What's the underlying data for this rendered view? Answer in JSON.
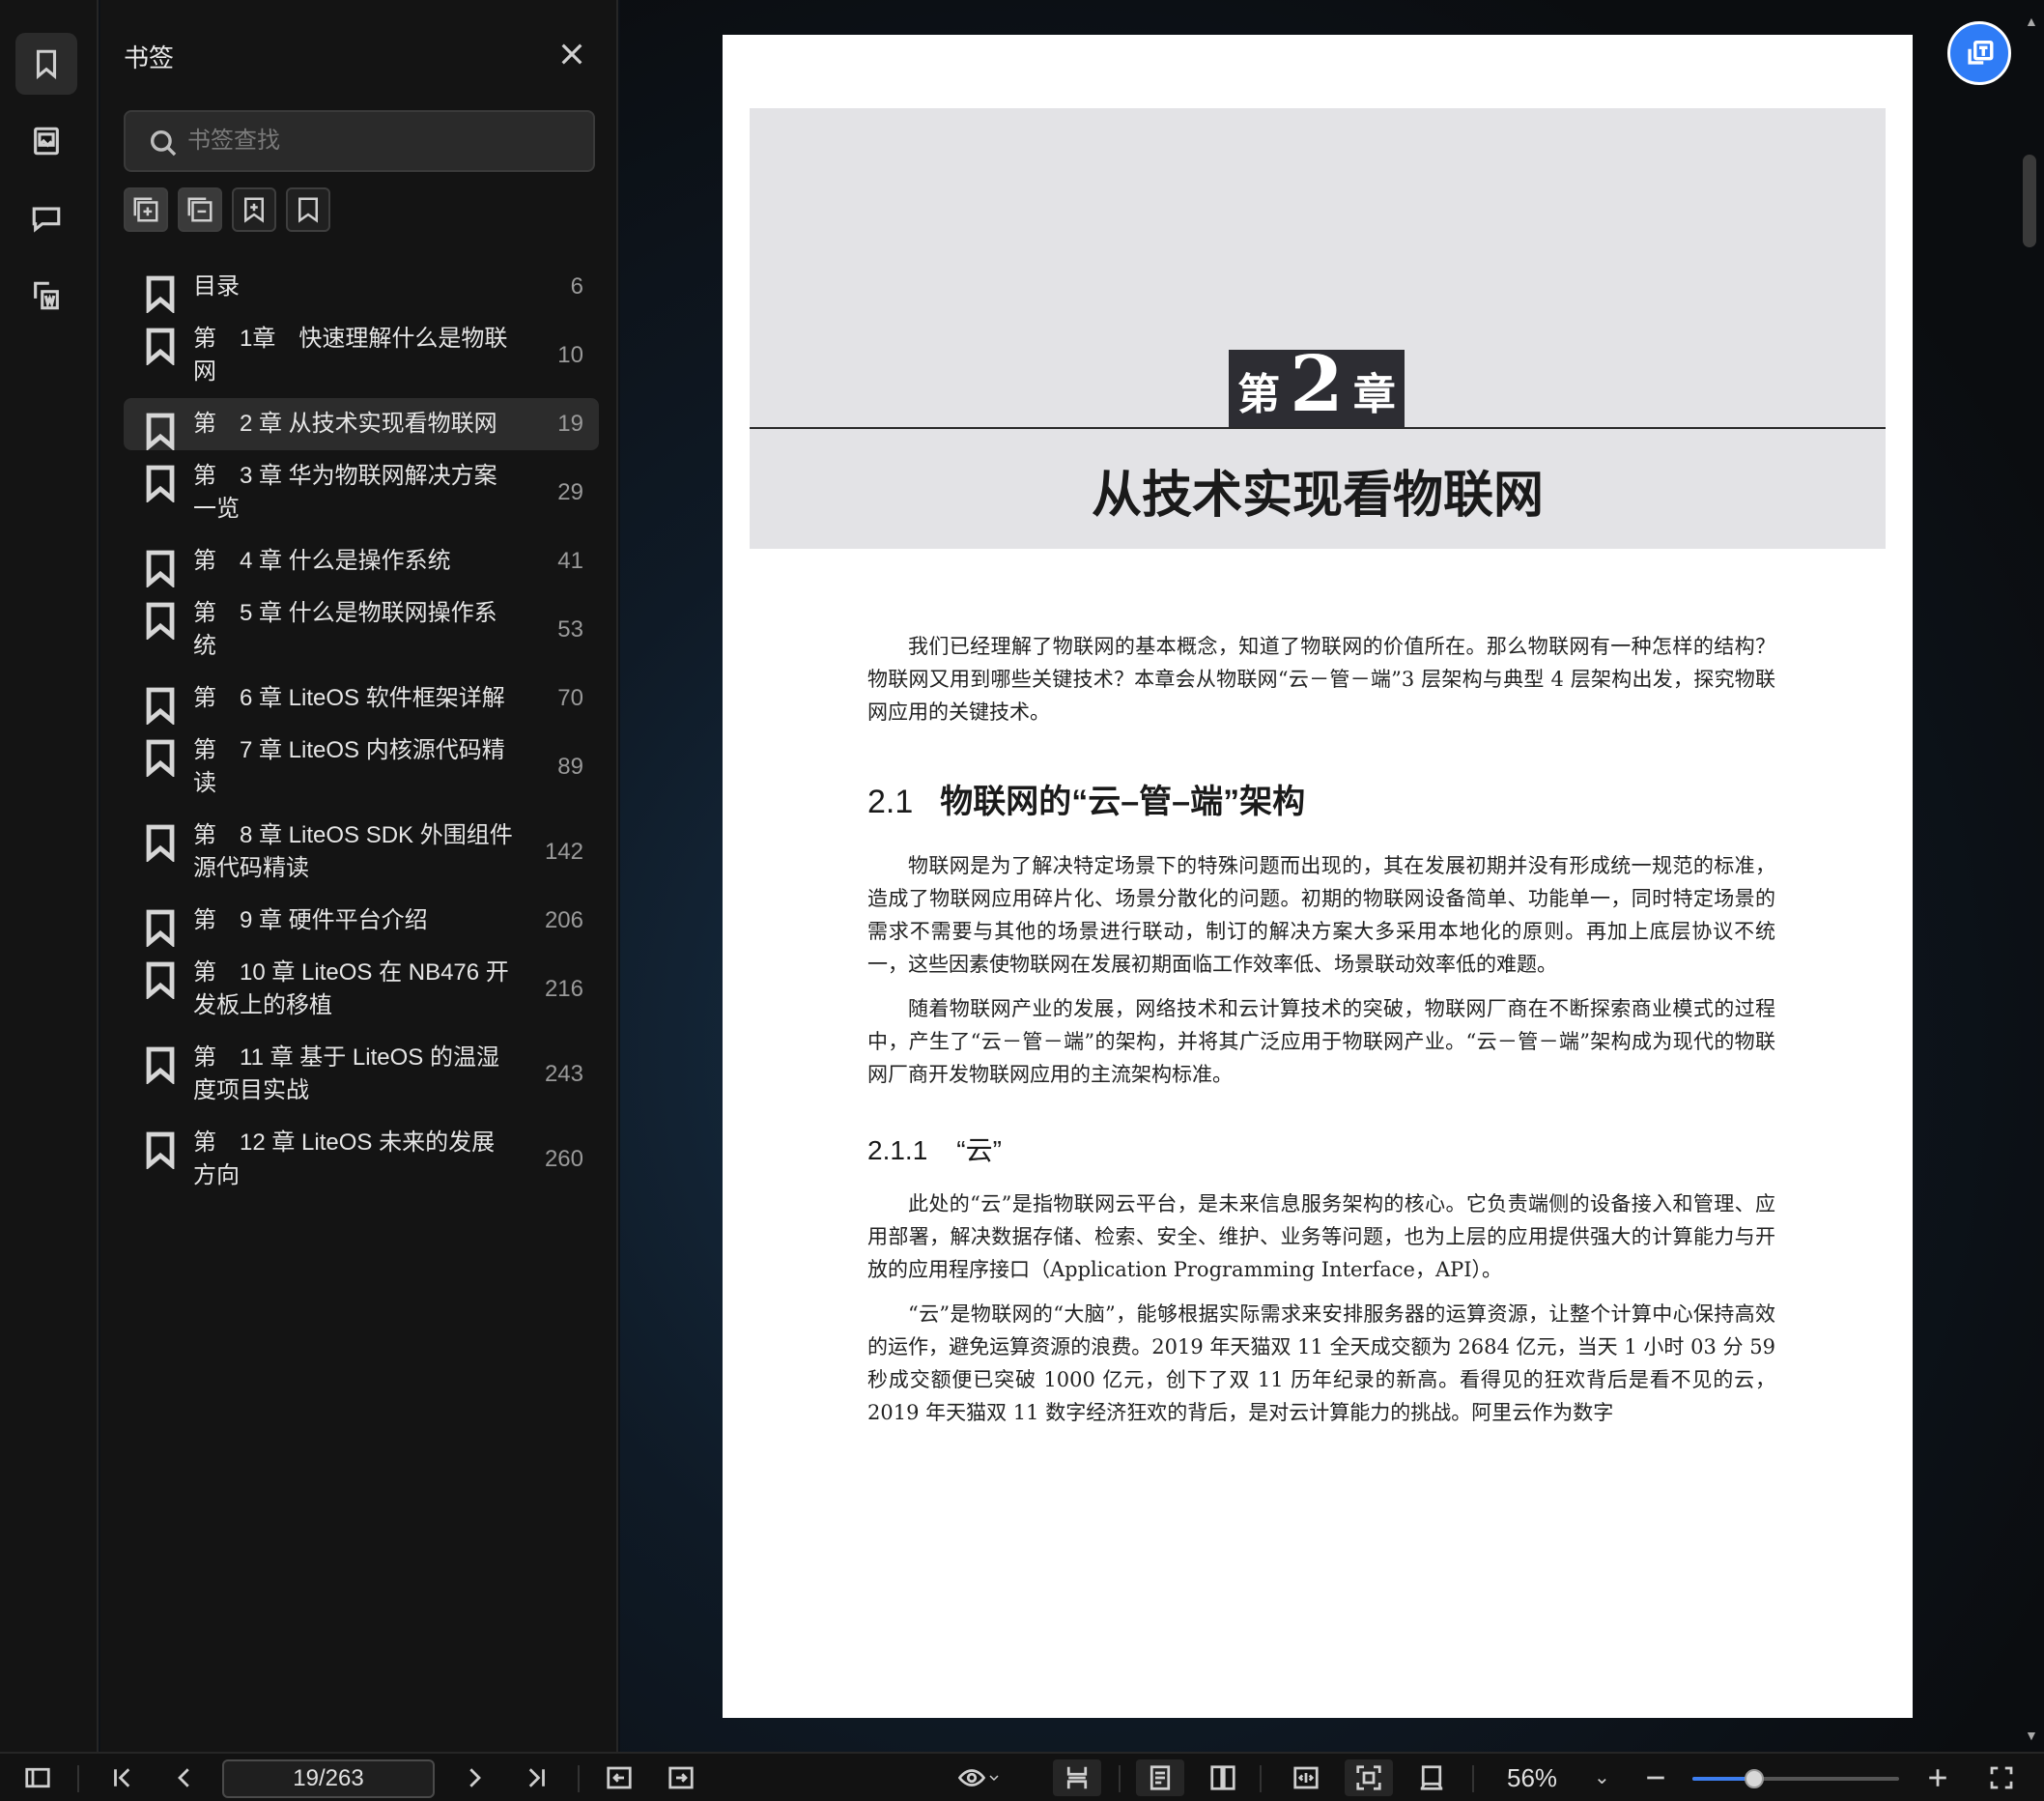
{
  "panel": {
    "title": "书签",
    "search_placeholder": "书签查找"
  },
  "bookmarks": [
    {
      "label": "目录",
      "page": "6"
    },
    {
      "label": "第　1章　快速理解什么是物联网",
      "page": "10"
    },
    {
      "label": "第　2 章 从技术实现看物联网",
      "page": "19",
      "active": true
    },
    {
      "label": "第　3 章 华为物联网解决方案一览",
      "page": "29"
    },
    {
      "label": "第　4 章 什么是操作系统",
      "page": "41"
    },
    {
      "label": "第　5 章 什么是物联网操作系统",
      "page": "53"
    },
    {
      "label": "第　6 章 LiteOS 软件框架详解",
      "page": "70"
    },
    {
      "label": "第　7 章 LiteOS 内核源代码精读",
      "page": "89"
    },
    {
      "label": "第　8 章 LiteOS SDK 外围组件源代码精读",
      "page": "142"
    },
    {
      "label": "第　9 章 硬件平台介绍",
      "page": "206"
    },
    {
      "label": "第　10 章 LiteOS 在 NB476 开发板上的移植",
      "page": "216"
    },
    {
      "label": "第　11 章 基于 LiteOS 的温湿度项目实战",
      "page": "243"
    },
    {
      "label": "第　12 章 LiteOS 未来的发展方向",
      "page": "260"
    }
  ],
  "document": {
    "chapter_prefix": "第",
    "chapter_number": "2",
    "chapter_suffix": "章",
    "chapter_title": "从技术实现看物联网",
    "intro": "我们已经理解了物联网的基本概念，知道了物联网的价值所在。那么物联网有一种怎样的结构？物联网又用到哪些关键技术？本章会从物联网“云－管－端”3 层架构与典型 4 层架构出发，探究物联网应用的关键技术。",
    "section_num": "2.1",
    "section_title": "物联网的“云–管–端”架构",
    "section_p1": "物联网是为了解决特定场景下的特殊问题而出现的，其在发展初期并没有形成统一规范的标准，造成了物联网应用碎片化、场景分散化的问题。初期的物联网设备简单、功能单一，同时特定场景的需求不需要与其他的场景进行联动，制订的解决方案大多采用本地化的原则。再加上底层协议不统一，这些因素使物联网在发展初期面临工作效率低、场景联动效率低的难题。",
    "section_p2": "随着物联网产业的发展，网络技术和云计算技术的突破，物联网厂商在不断探索商业模式的过程中，产生了“云－管－端”的架构，并将其广泛应用于物联网产业。“云－管－端”架构成为现代的物联网厂商开发物联网应用的主流架构标准。",
    "subsection_num": "2.1.1",
    "subsection_title": "“云”",
    "sub_p1": "此处的“云”是指物联网云平台，是未来信息服务架构的核心。它负责端侧的设备接入和管理、应用部署，解决数据存储、检索、安全、维护、业务等问题，也为上层的应用提供强大的计算能力与开放的应用程序接口（Application Programming Interface，API）。",
    "sub_p2": "“云”是物联网的“大脑”，能够根据实际需求来安排服务器的运算资源，让整个计算中心保持高效的运作，避免运算资源的浪费。2019 年天猫双 11 全天成交额为 2684 亿元，当天 1 小时 03 分 59 秒成交额便已突破 1000 亿元，创下了双 11 历年纪录的新高。看得见的狂欢背后是看不见的云，2019 年天猫双 11 数字经济狂欢的背后，是对云计算能力的挑战。阿里云作为数字"
  },
  "toolbar": {
    "page_indicator": "19/263",
    "zoom": "56%",
    "zoom_fraction": 0.3
  }
}
